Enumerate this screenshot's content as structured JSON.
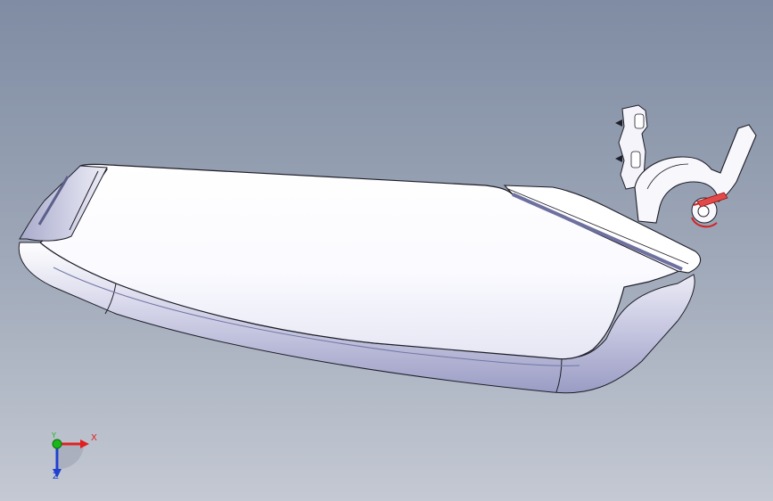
{
  "viewport": {
    "background_top": "#7f8ca3",
    "background_bottom": "#c4c9d3"
  },
  "model": {
    "part_color": "#ffffff",
    "edge_color": "#1e1e28",
    "shade_color": "#8f91b8",
    "hinge_accent_color": "#d42222"
  },
  "triad": {
    "x_label": "X",
    "y_label": "Y",
    "z_label": "Z",
    "x_color": "#e02020",
    "y_color": "#18b818",
    "z_color": "#2040d0"
  }
}
